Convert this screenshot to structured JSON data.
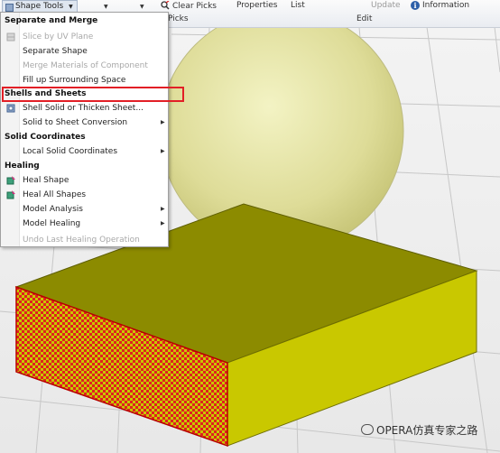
{
  "ribbon": {
    "shape_tools": "Shape Tools",
    "clear_picks": "Clear Picks",
    "picks_group": "Picks",
    "properties": "Properties",
    "list": "List",
    "update": "Update",
    "information": "Information",
    "edit_group": "Edit"
  },
  "menu": {
    "sections": [
      {
        "header": "Separate and Merge"
      },
      {
        "header": "Shells and Sheets"
      },
      {
        "header": "Solid Coordinates"
      },
      {
        "header": "Healing"
      }
    ],
    "items": [
      {
        "label": "Slice by UV Plane",
        "enabled": false
      },
      {
        "label": "Separate Shape",
        "enabled": true
      },
      {
        "label": "Merge Materials of Component",
        "enabled": false
      },
      {
        "label": "Fill up Surrounding Space",
        "enabled": true
      },
      {
        "label": "Shell Solid or Thicken Sheet...",
        "enabled": true,
        "highlighted": true
      },
      {
        "label": "Solid to Sheet Conversion",
        "enabled": true,
        "submenu": true
      },
      {
        "label": "Local Solid Coordinates",
        "enabled": true,
        "submenu": true
      },
      {
        "label": "Heal Shape",
        "enabled": true
      },
      {
        "label": "Heal All Shapes",
        "enabled": true
      },
      {
        "label": "Model Analysis",
        "enabled": true,
        "submenu": true
      },
      {
        "label": "Model Healing",
        "enabled": true,
        "submenu": true
      },
      {
        "label": "Undo Last Healing Operation",
        "enabled": false
      }
    ]
  },
  "watermark": "OPERA仿真专家之路",
  "colors": {
    "accent_red": "#e21f26",
    "block_top": "#888800",
    "block_right": "#c8c800",
    "sphere": "#dcdc8c",
    "hatch_red": "#e02020"
  }
}
